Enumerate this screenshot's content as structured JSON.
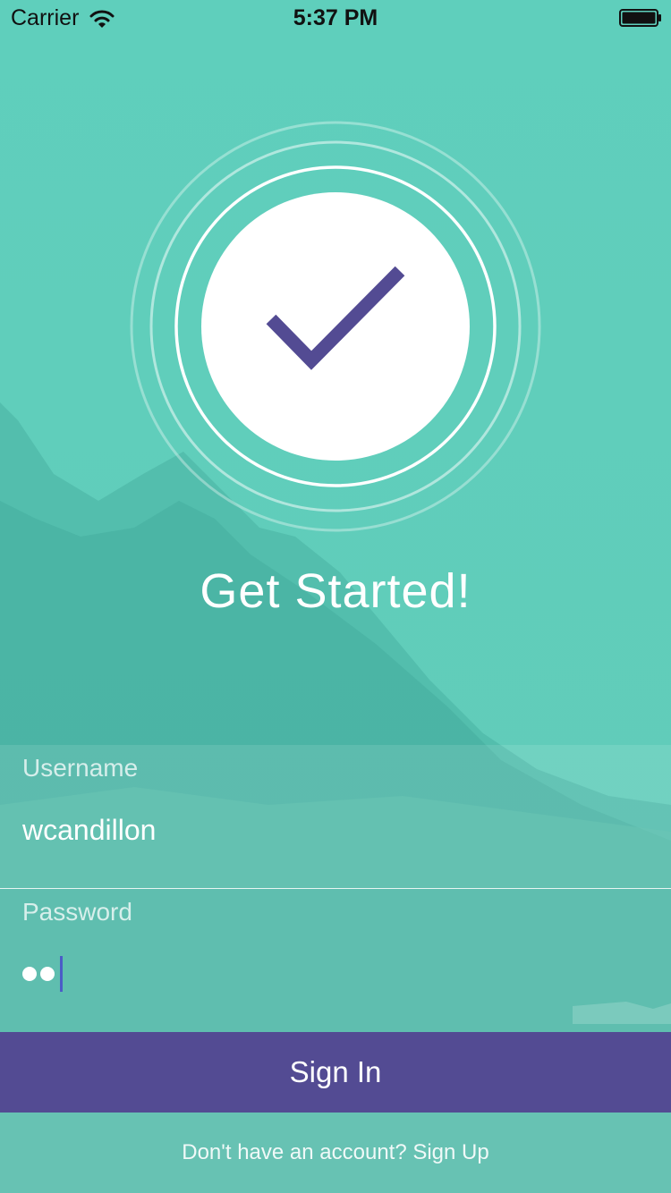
{
  "status_bar": {
    "carrier": "Carrier",
    "time": "5:37 PM",
    "wifi_icon": "wifi-icon",
    "battery_icon": "battery-icon"
  },
  "hero": {
    "icon": "checkmark-icon",
    "title": "Get Started!"
  },
  "form": {
    "username_label": "Username",
    "username_value": "wcandillon",
    "password_label": "Password",
    "password_length": 2
  },
  "actions": {
    "sign_in_label": "Sign In",
    "footer_text": "Don't have an account? Sign Up"
  },
  "colors": {
    "background": "#5fcfbc",
    "accent": "#534b93",
    "checkmark": "#534b93"
  }
}
